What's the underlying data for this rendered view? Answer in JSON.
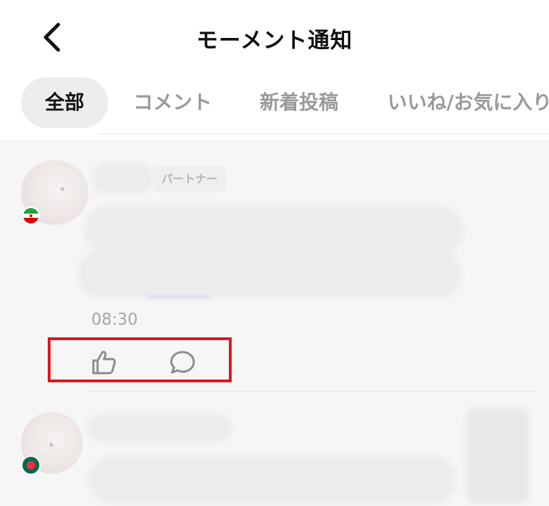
{
  "header": {
    "title": "モーメント通知",
    "back_icon": "chevron-left-icon"
  },
  "tabs": [
    {
      "label": "全部",
      "active": true
    },
    {
      "label": "コメント",
      "active": false
    },
    {
      "label": "新着投稿",
      "active": false
    },
    {
      "label": "いいね/お気に入り",
      "active": false
    }
  ],
  "notifications": [
    {
      "badge": "パートナー",
      "time": "08:30",
      "actions": {
        "like_icon": "thumbs-up-icon",
        "comment_icon": "speech-bubble-icon"
      },
      "flag": "iran-flag"
    },
    {
      "flag": "bangladesh-flag"
    }
  ],
  "colors": {
    "highlight": "#e3141b",
    "icon": "#8c8c8c",
    "active_tab_bg": "#ededed"
  }
}
